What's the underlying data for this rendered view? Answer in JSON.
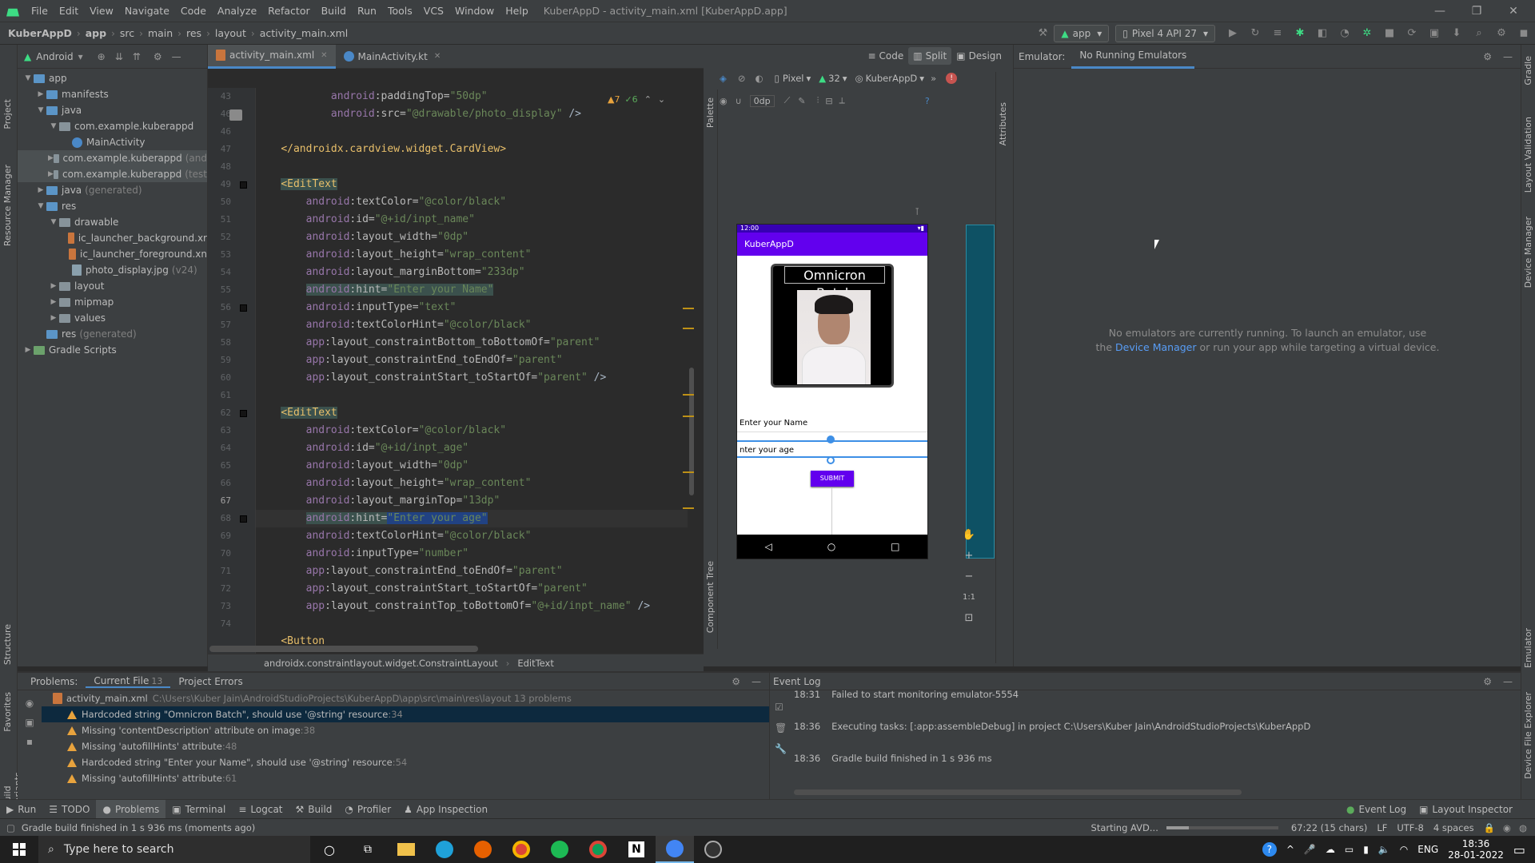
{
  "menubar": {
    "items": [
      "File",
      "Edit",
      "View",
      "Navigate",
      "Code",
      "Analyze",
      "Refactor",
      "Build",
      "Run",
      "Tools",
      "VCS",
      "Window",
      "Help"
    ],
    "title": "KuberAppD - activity_main.xml [KuberAppD.app]"
  },
  "navbar": {
    "crumbs": [
      "KuberAppD",
      "app",
      "src",
      "main",
      "res",
      "layout",
      "activity_main.xml"
    ],
    "run_config": "app",
    "device": "Pixel 4 API 27"
  },
  "project": {
    "view_mode": "Android",
    "tree": [
      {
        "label": "app",
        "indent": 0,
        "arrow": "▼",
        "type": "folder-blue"
      },
      {
        "label": "manifests",
        "indent": 1,
        "arrow": "▶",
        "type": "folder-blue"
      },
      {
        "label": "java",
        "indent": 1,
        "arrow": "▼",
        "type": "folder-blue"
      },
      {
        "label": "com.example.kuberappd",
        "indent": 2,
        "arrow": "▼",
        "type": "folder"
      },
      {
        "label": "MainActivity",
        "indent": 3,
        "arrow": "",
        "type": "kt"
      },
      {
        "label": "com.example.kuberappd",
        "suffix": "(and",
        "indent": 2,
        "arrow": "▶",
        "type": "folder",
        "sel": true
      },
      {
        "label": "com.example.kuberappd",
        "suffix": "(test",
        "indent": 2,
        "arrow": "▶",
        "type": "folder",
        "sel": true
      },
      {
        "label": "java",
        "suffix": "(generated)",
        "indent": 1,
        "arrow": "▶",
        "type": "folder-blue"
      },
      {
        "label": "res",
        "indent": 1,
        "arrow": "▼",
        "type": "folder-blue"
      },
      {
        "label": "drawable",
        "indent": 2,
        "arrow": "▼",
        "type": "folder"
      },
      {
        "label": "ic_launcher_background.xr",
        "indent": 3,
        "arrow": "",
        "type": "xml"
      },
      {
        "label": "ic_launcher_foreground.xn",
        "indent": 3,
        "arrow": "",
        "type": "xml"
      },
      {
        "label": "photo_display.jpg",
        "suffix": "(v24)",
        "indent": 3,
        "arrow": "",
        "type": "img"
      },
      {
        "label": "layout",
        "indent": 2,
        "arrow": "▶",
        "type": "folder"
      },
      {
        "label": "mipmap",
        "indent": 2,
        "arrow": "▶",
        "type": "folder"
      },
      {
        "label": "values",
        "indent": 2,
        "arrow": "▶",
        "type": "folder"
      },
      {
        "label": "res",
        "suffix": "(generated)",
        "indent": 1,
        "arrow": "",
        "type": "folder-blue"
      },
      {
        "label": "Gradle Scripts",
        "indent": 0,
        "arrow": "▶",
        "type": "gradle"
      }
    ]
  },
  "editor": {
    "tabs": [
      "activity_main.xml",
      "MainActivity.kt"
    ],
    "warnings": "▲7",
    "checks": "✓6",
    "line_numbers": [
      "43",
      "46",
      "46",
      "47",
      "48",
      "49",
      "50",
      "51",
      "52",
      "53",
      "54",
      "55",
      "56",
      "57",
      "58",
      "59",
      "60",
      "61",
      "62",
      "63",
      "64",
      "65",
      "66",
      "67",
      "68",
      "69",
      "70",
      "71",
      "72",
      "73",
      "74"
    ],
    "current_line": "67",
    "breadcrumb": [
      "androidx.constraintlayout.widget.ConstraintLayout",
      "EditText"
    ]
  },
  "design": {
    "views": [
      "Code",
      "Split",
      "Design"
    ],
    "device": "Pixel",
    "api": "32",
    "theme": "KuberAppD",
    "margin": "0dp",
    "palette": "Palette",
    "component_tree": "Component Tree",
    "attributes": "Attributes"
  },
  "phone": {
    "time": "12:00",
    "app_title": "KuberAppD",
    "card_title": "Omnicron Batch",
    "hint_name": "Enter your Name",
    "hint_age": "nter your age",
    "submit": "SUBMIT"
  },
  "emulator": {
    "label": "Emulator:",
    "tab": "No Running Emulators",
    "msg1": "No emulators are currently running. To launch an emulator, use",
    "msg2_pre": "the",
    "msg2_link": "Device Manager",
    "msg2_post": "or run your app while targeting a virtual device."
  },
  "problems": {
    "tabs": [
      {
        "label": "Problems:",
        "count": ""
      },
      {
        "label": "Current File",
        "count": "13"
      },
      {
        "label": "Project Errors",
        "count": ""
      }
    ],
    "file": "activity_main.xml",
    "path": "C:\\Users\\Kuber Jain\\AndroidStudioProjects\\KuberAppD\\app\\src\\main\\res\\layout  13 problems",
    "rows": [
      {
        "text": "Hardcoded string \"Omnicron Batch\", should use '@string' resource",
        "line": ":34",
        "sel": true
      },
      {
        "text": "Missing 'contentDescription' attribute on image",
        "line": ":38"
      },
      {
        "text": "Missing 'autofillHints' attribute",
        "line": ":48"
      },
      {
        "text": "Hardcoded string \"Enter your Name\", should use '@string' resource",
        "line": ":54"
      },
      {
        "text": "Missing 'autofillHints' attribute",
        "line": ":61"
      }
    ]
  },
  "eventlog": {
    "title": "Event Log",
    "lines": [
      {
        "time": "18:31",
        "text": "Failed to start monitoring emulator-5554"
      },
      {
        "time": "18:36",
        "text": "Executing tasks: [:app:assembleDebug] in project C:\\Users\\Kuber Jain\\AndroidStudioProjects\\KuberAppD"
      },
      {
        "time": "18:36",
        "text": "Gradle build finished in 1 s 936 ms"
      }
    ]
  },
  "bottom_tools": {
    "left": [
      "Run",
      "TODO",
      "Problems",
      "Terminal",
      "Logcat",
      "Build",
      "Profiler",
      "App Inspection"
    ],
    "right": [
      "Event Log",
      "Layout Inspector"
    ]
  },
  "status": {
    "message": "Gradle build finished in 1 s 936 ms (moments ago)",
    "avd": "Starting AVD...",
    "position": "67:22 (15 chars)",
    "line_sep": "LF",
    "encoding": "UTF-8",
    "indent": "4 spaces"
  },
  "taskbar": {
    "search": "Type here to search",
    "lang": "ENG",
    "time": "18:36",
    "date": "28-01-2022"
  },
  "left_tools": [
    "Project",
    "Resource Manager",
    "Structure",
    "Favorites",
    "Build Variants"
  ],
  "right_tools": [
    "Gradle",
    "Layout Validation",
    "Device Manager",
    "Emulator",
    "Device File Explorer"
  ]
}
